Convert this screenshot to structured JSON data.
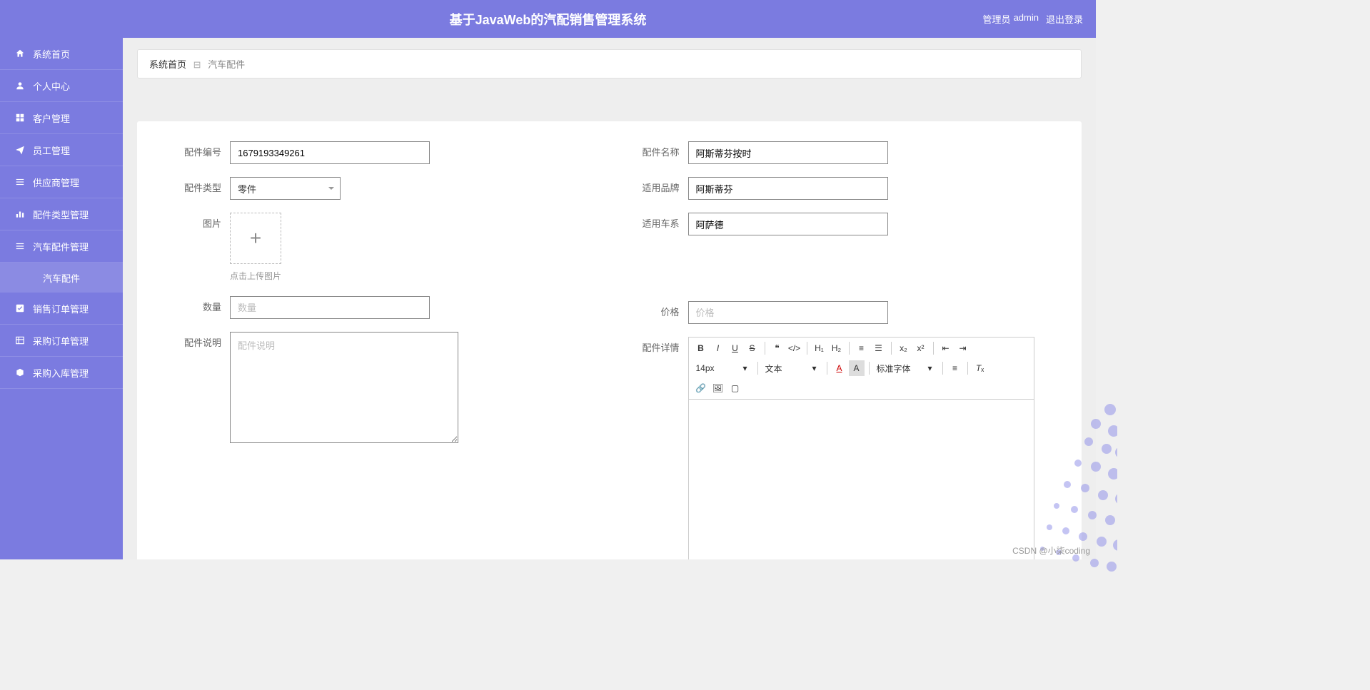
{
  "header": {
    "title": "基于JavaWeb的汽配销售管理系统",
    "user_role": "管理员",
    "username": "admin",
    "logout": "退出登录"
  },
  "sidebar": {
    "items": [
      {
        "icon": "home",
        "label": "系统首页"
      },
      {
        "icon": "person",
        "label": "个人中心"
      },
      {
        "icon": "grid",
        "label": "客户管理"
      },
      {
        "icon": "send",
        "label": "员工管理"
      },
      {
        "icon": "list",
        "label": "供应商管理"
      },
      {
        "icon": "bars",
        "label": "配件类型管理"
      },
      {
        "icon": "menu",
        "label": "汽车配件管理"
      },
      {
        "icon": "check",
        "label": "销售订单管理"
      },
      {
        "icon": "table",
        "label": "采购订单管理"
      },
      {
        "icon": "box",
        "label": "采购入库管理"
      }
    ],
    "sub_item": "汽车配件"
  },
  "breadcrumb": {
    "home": "系统首页",
    "current": "汽车配件"
  },
  "form": {
    "part_no_label": "配件编号",
    "part_no_value": "1679193349261",
    "part_name_label": "配件名称",
    "part_name_value": "阿斯蒂芬按时",
    "part_type_label": "配件类型",
    "part_type_value": "零件",
    "brand_label": "适用品牌",
    "brand_value": "阿斯蒂芬",
    "image_label": "图片",
    "series_label": "适用车系",
    "series_value": "阿萨德",
    "upload_hint": "点击上传图片",
    "qty_label": "数量",
    "qty_placeholder": "数量",
    "price_label": "价格",
    "price_placeholder": "价格",
    "desc_label": "配件说明",
    "desc_placeholder": "配件说明",
    "detail_label": "配件详情"
  },
  "editor": {
    "font_size": "14px",
    "style_sel": "文本",
    "font_family": "标准字体"
  },
  "watermark": "CSDN @小柒coding"
}
